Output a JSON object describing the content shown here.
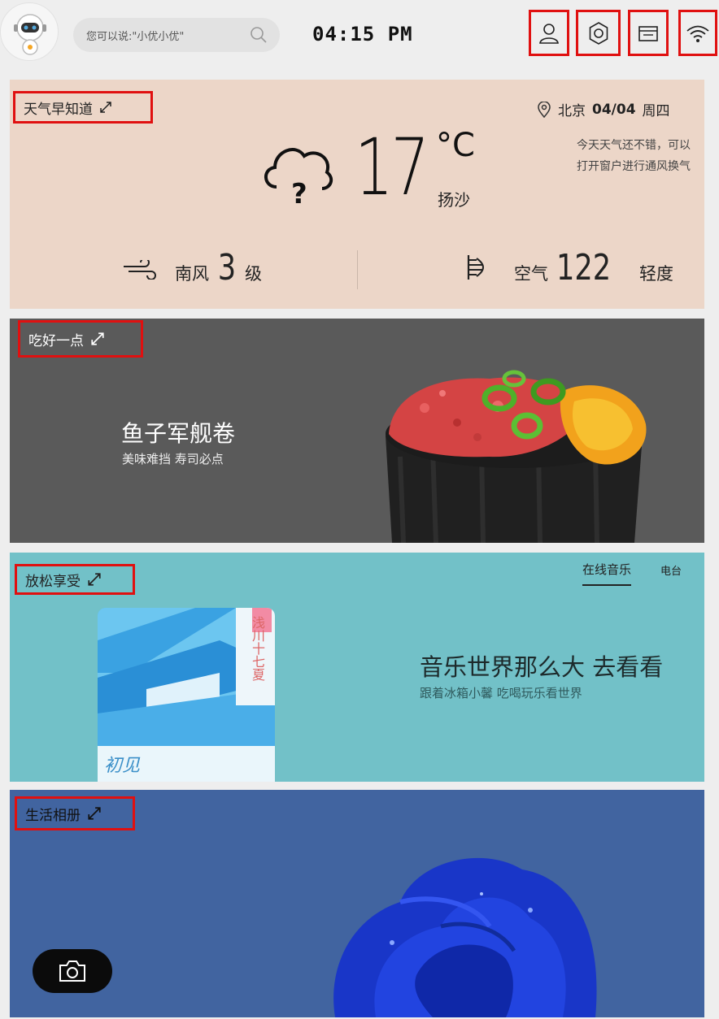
{
  "topbar": {
    "search_placeholder": "您可以说:\"小优小优\"",
    "time": "04:15 PM"
  },
  "weather": {
    "title": "天气早知道",
    "location": "北京",
    "date": "04/04",
    "weekday": "周四",
    "tip_line1": "今天天气还不错，可以",
    "tip_line2": "打开窗户进行通风换气",
    "temperature": "17",
    "unit": "°C",
    "condition": "扬沙",
    "wind_direction": "南风",
    "wind_level": "3",
    "wind_unit": "级",
    "air_label": "空气",
    "air_value": "122",
    "air_quality": "轻度"
  },
  "food": {
    "title": "吃好一点",
    "dish": "鱼子军舰卷",
    "subtitle": "美味难挡 寿司必点"
  },
  "music": {
    "title": "放松享受",
    "tab_online": "在线音乐",
    "tab_radio": "电台",
    "headline": "音乐世界那么大 去看看",
    "subtitle": "跟着冰箱小馨 吃喝玩乐看世界",
    "album_vertical_text": "浅川十七夏",
    "album_bottom_text": "初见"
  },
  "album": {
    "title": "生活相册"
  },
  "colors": {
    "highlight": "#e01010",
    "weather_bg": "#ecd6c8",
    "food_bg": "#5a5a5a",
    "music_bg": "#72c1c8",
    "album_bg": "#4164a0"
  }
}
